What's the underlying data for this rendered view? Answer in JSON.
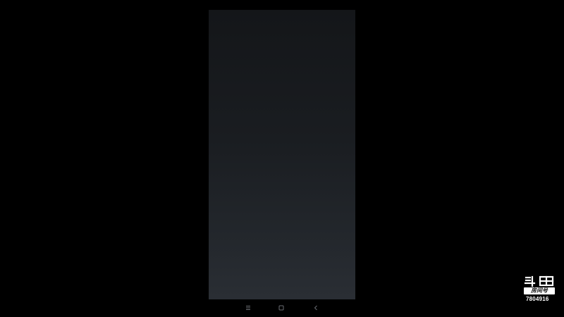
{
  "screen": {
    "background_top": "#141619",
    "background_bottom": "#2a2e34"
  },
  "nav_bar": {
    "icons": [
      "menu-lines-icon",
      "home-square-icon",
      "back-chevron-icon"
    ],
    "icon_color": "#6a6d72"
  },
  "watermark": {
    "logo_text": "斗鱼",
    "badge_text": "房间号",
    "room_number": "7804916"
  }
}
